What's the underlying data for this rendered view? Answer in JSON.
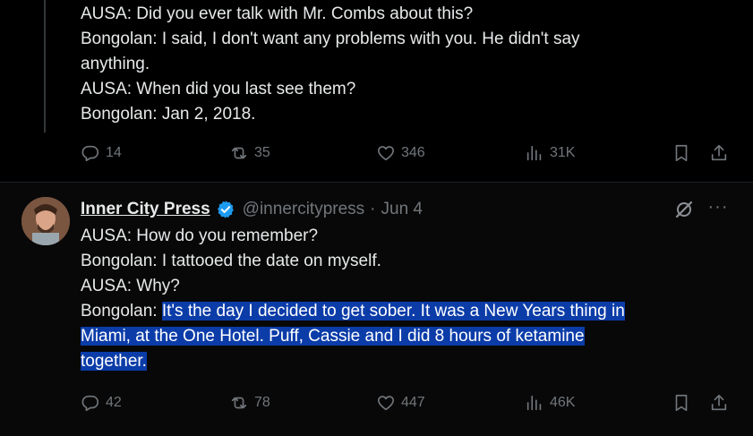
{
  "tweet1": {
    "lines": [
      "AUSA: Did you ever talk with Mr. Combs about this?",
      "Bongolan: I said, I don't want any problems with you. He didn't say",
      "anything.",
      "AUSA: When did you last see them?",
      "Bongolan: Jan 2, 2018."
    ],
    "replies": "14",
    "reposts": "35",
    "likes": "346",
    "views": "31K"
  },
  "tweet2": {
    "author_name": "Inner City Press",
    "handle": "@innercitypress",
    "separator": "·",
    "date": "Jun 4",
    "more_label": "···",
    "lines": [
      "AUSA: How do you remember?",
      "Bongolan: I tattooed the date on myself.",
      "AUSA: Why?"
    ],
    "line4_prefix": "Bongolan: ",
    "line4_highlighted": "It's the day I decided to get sober. It was a New Years thing in",
    "line5_highlighted": "Miami, at the One Hotel. Puff, Cassie and I did 8 hours of ketamine",
    "line6_highlighted": "together.",
    "replies": "42",
    "reposts": "78",
    "likes": "447",
    "views": "46K"
  },
  "icons": {
    "reply": "reply-icon",
    "repost": "repost-icon",
    "like": "heart-icon",
    "views": "views-icon",
    "bookmark": "bookmark-icon",
    "share": "share-icon",
    "verified": "verified-badge-icon",
    "grok": "grok-icon",
    "more": "more-icon"
  },
  "colors": {
    "background": "#000000",
    "text": "#e7e9ea",
    "muted": "#71767b",
    "selection": "#0b3ca8",
    "verified": "#1d9bf0"
  }
}
